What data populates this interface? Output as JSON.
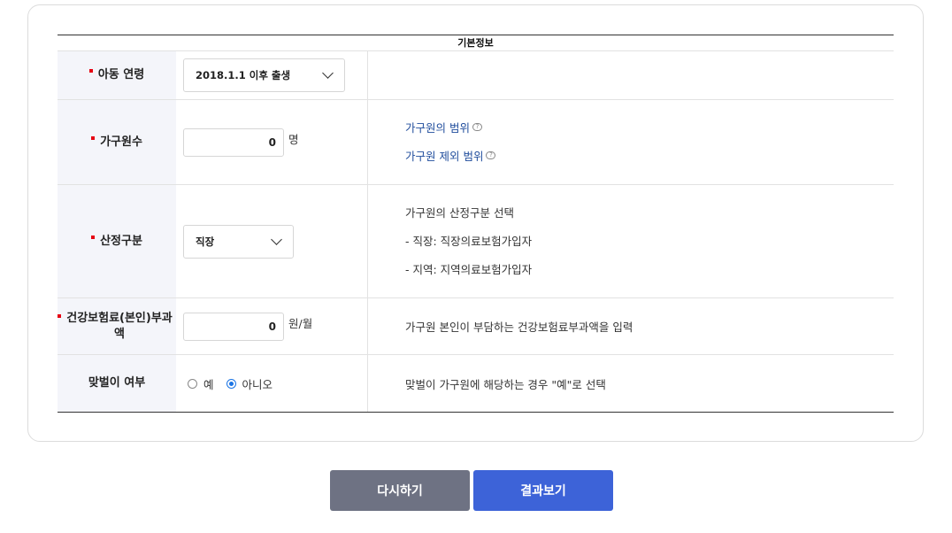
{
  "table": {
    "caption": "기본정보",
    "rows": [
      {
        "label": "아동 연령",
        "select_value": "2018.1.1 이후 출생"
      },
      {
        "label": "가구원수",
        "input_value": "0",
        "unit": "명",
        "links": [
          "가구원의 범위",
          "가구원 제외 범위"
        ]
      },
      {
        "label": "산정구분",
        "select_value": "직장",
        "desc": [
          "가구원의 산정구분 선택",
          "- 직장: 직장의료보험가입자",
          "- 지역: 지역의료보험가입자"
        ]
      },
      {
        "label": "건강보험료(본인)부과액",
        "input_value": "0",
        "unit": "원/월",
        "desc": "가구원 본인이 부담하는 건강보험료부과액을 입력"
      },
      {
        "label": "맞벌이 여부",
        "options": [
          "예",
          "아니오"
        ],
        "selected": "아니오",
        "desc": "맞벌이 가구원에 해당하는 경우 \"예\"로 선택"
      }
    ]
  },
  "buttons": {
    "reset": "다시하기",
    "result": "결과보기"
  },
  "colors": {
    "required_marker": "#e60012",
    "link": "#1f4c9c",
    "reset_btn": "#6e7283",
    "result_btn": "#3d63d8"
  }
}
